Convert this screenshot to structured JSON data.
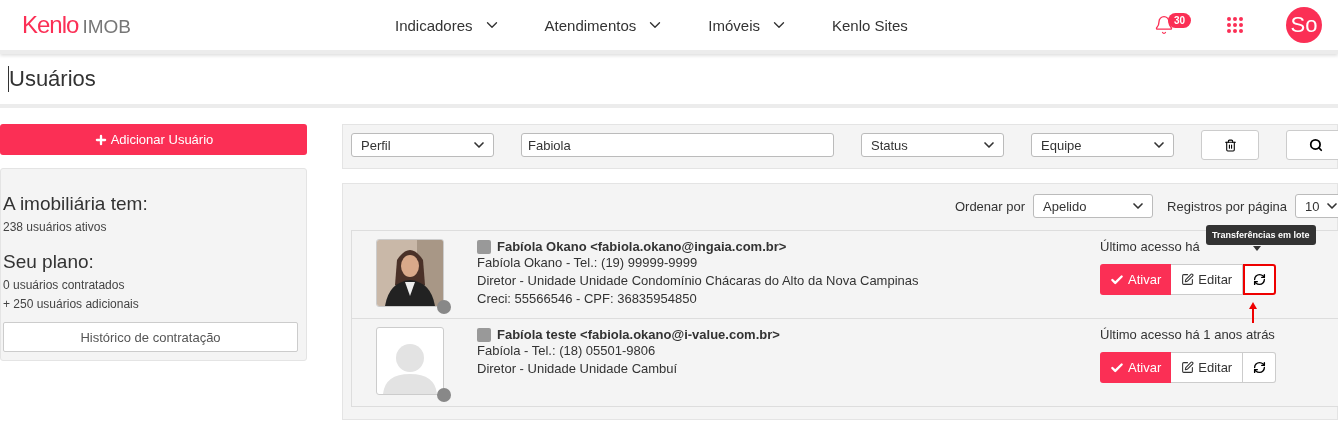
{
  "brand": {
    "name": "Kenlo",
    "suffix": "IMOB"
  },
  "nav": [
    {
      "label": "Indicadores",
      "dropdown": true
    },
    {
      "label": "Atendimentos",
      "dropdown": true
    },
    {
      "label": "Imóveis",
      "dropdown": true
    },
    {
      "label": "Kenlo Sites",
      "dropdown": false
    }
  ],
  "notifications": {
    "count": "30"
  },
  "avatar": {
    "initials": "So"
  },
  "page_title": "Usuários",
  "add_button": "Adicionar Usuário",
  "summary": {
    "heading": "A imobiliária tem:",
    "lines": [
      "238 usuários ativos"
    ],
    "plan_heading": "Seu plano:",
    "plan_lines": [
      "0 usuários contratados",
      "+ 250 usuários adicionais"
    ],
    "history_button": "Histórico de contratação"
  },
  "filters": [
    {
      "kind": "select",
      "value": "Perfil"
    },
    {
      "kind": "input",
      "value": "Fabiola"
    },
    {
      "kind": "select",
      "value": "Status"
    },
    {
      "kind": "select",
      "value": "Equipe"
    }
  ],
  "sort": {
    "label": "Ordenar por",
    "value": "Apelido"
  },
  "per_page": {
    "label": "Registros por página",
    "value": "10"
  },
  "users": [
    {
      "name": "Fabíola Okano <fabiola.okano@ingaia.com.br>",
      "lines": [
        "Fabíola Okano - Tel.: (19) 99999-9999",
        "Diretor  - Unidade Unidade Condomínio Chácaras do Alto da Nova Campinas",
        "Creci: 55566546 - CPF: 36835954850"
      ],
      "last_access": "Último acesso há",
      "activate": "Ativar",
      "edit": "Editar",
      "highlighted": true,
      "tooltip": "Transferências em lote"
    },
    {
      "kind": "placeholder",
      "name": "Fabíola teste <fabiola.okano@i-value.com.br>",
      "lines": [
        "Fabíola - Tel.: (18) 05501-9806",
        "Diretor  - Unidade Unidade Cambuí"
      ],
      "last_access": "Último acesso há 1 anos atrás",
      "activate": "Ativar",
      "edit": "Editar",
      "highlighted": false
    }
  ]
}
